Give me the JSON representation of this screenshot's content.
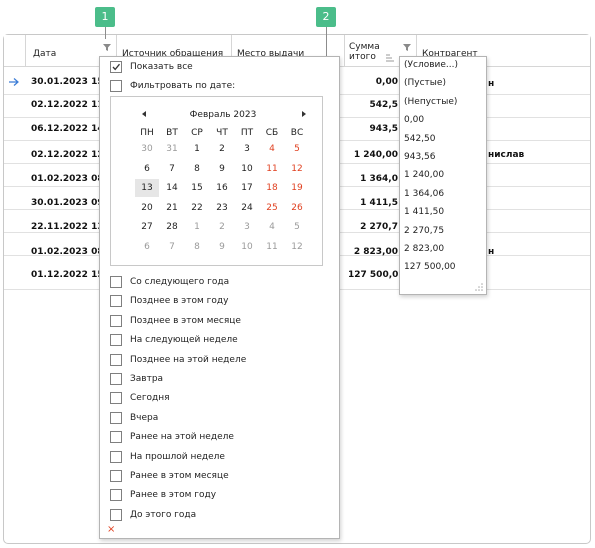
{
  "callouts": [
    "1",
    "2"
  ],
  "columns": {
    "date": "Дата",
    "source": "Источник обращения",
    "place": "Место выдачи",
    "sum_line1": "Сумма",
    "sum_line2": "итого",
    "counterparty": "Контрагент"
  },
  "rows": [
    {
      "date": "30.01.2023 15",
      "sum": "0,00",
      "contr": "н",
      "current": true
    },
    {
      "date": "02.12.2022 11",
      "sum": "542,5",
      "contr": ""
    },
    {
      "date": "06.12.2022 14",
      "sum": "943,5",
      "contr": ""
    },
    {
      "date": "02.12.2022 12",
      "sum": "1 240,00",
      "contr": "нислав"
    },
    {
      "date": "01.02.2023 08",
      "sum": "1 364,0",
      "contr": ""
    },
    {
      "date": "30.01.2023 09",
      "sum": "1 411,5",
      "contr": ""
    },
    {
      "date": "22.11.2022 13",
      "sum": "2 270,7",
      "contr": ""
    },
    {
      "date": "01.02.2023 08",
      "sum": "2 823,00",
      "contr": "н"
    },
    {
      "date": "01.12.2022 15",
      "sum": "127 500,00",
      "contr": ""
    }
  ],
  "date_filter": {
    "show_all": "Показать все",
    "filter_by_date": "Фильтровать по дате:",
    "month_label": "Февраль 2023",
    "weekdays": [
      "ПН",
      "ВТ",
      "СР",
      "ЧТ",
      "ПТ",
      "СБ",
      "ВС"
    ],
    "weeks": [
      [
        "30",
        "31",
        "1",
        "2",
        "3",
        "4",
        "5"
      ],
      [
        "6",
        "7",
        "8",
        "9",
        "10",
        "11",
        "12"
      ],
      [
        "13",
        "14",
        "15",
        "16",
        "17",
        "18",
        "19"
      ],
      [
        "20",
        "21",
        "22",
        "23",
        "24",
        "25",
        "26"
      ],
      [
        "27",
        "28",
        "1",
        "2",
        "3",
        "4",
        "5"
      ],
      [
        "6",
        "7",
        "8",
        "9",
        "10",
        "11",
        "12"
      ]
    ],
    "today": "13",
    "options": [
      "Со следующего года",
      "Позднее в этом году",
      "Позднее в этом месяце",
      "На следующей неделе",
      "Позднее на этой неделе",
      "Завтра",
      "Сегодня",
      "Вчера",
      "Ранее на этой неделе",
      "На прошлой неделе",
      "Ранее в этом месяце",
      "Ранее в этом году",
      "До этого года"
    ],
    "clear_symbol": "×"
  },
  "value_filter": {
    "items": [
      "(Условие...)",
      "(Пустые)",
      "(Непустые)",
      "0,00",
      "542,50",
      "943,56",
      "1 240,00",
      "1 364,06",
      "1 411,50",
      "2 270,75",
      "2 823,00",
      "127 500,00"
    ]
  },
  "colors": {
    "accent": "#4bbd8a",
    "weekend": "#e04020",
    "arrow": "#3a7bd5"
  }
}
